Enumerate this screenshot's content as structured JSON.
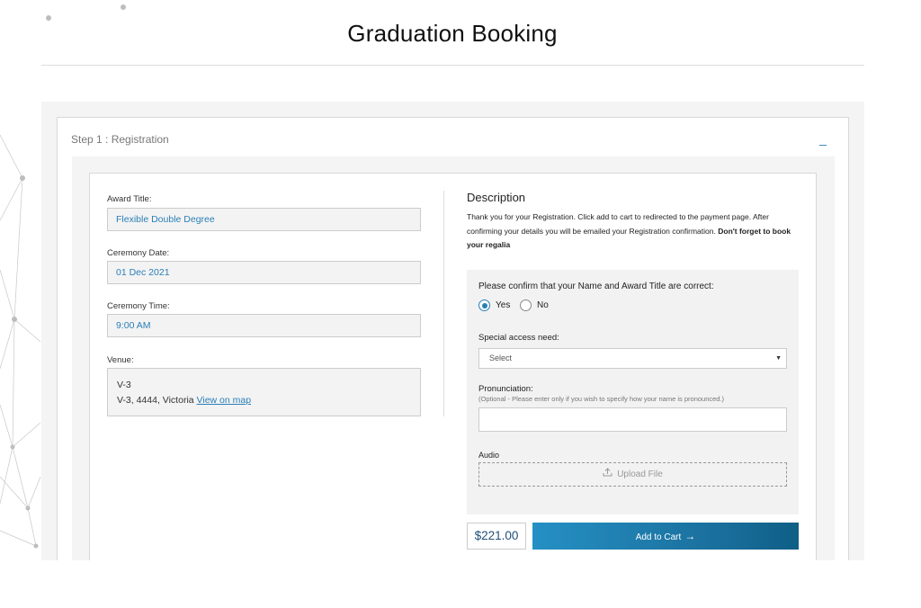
{
  "page": {
    "title": "Graduation Booking"
  },
  "step": {
    "title": "Step 1 : Registration",
    "collapse_symbol": "_"
  },
  "details": {
    "award_title": {
      "label": "Award Title:",
      "value": "Flexible Double Degree"
    },
    "ceremony_date": {
      "label": "Ceremony Date:",
      "value": "01 Dec 2021"
    },
    "ceremony_time": {
      "label": "Ceremony Time:",
      "value": "9:00 AM"
    },
    "venue": {
      "label": "Venue:",
      "name": "V-3",
      "address": "V-3, 4444, Victoria",
      "map_link": "View on map"
    }
  },
  "description": {
    "heading": "Description",
    "text": "Thank you for your Registration. Click add to cart to redirected to the payment page. After confirming your details you will be emailed your Registration confirmation.",
    "emphasis": "Don't forget to book your regalia"
  },
  "confirm": {
    "question": "Please confirm that your Name and Award Title are correct:",
    "options": [
      {
        "label": "Yes",
        "selected": true
      },
      {
        "label": "No",
        "selected": false
      }
    ]
  },
  "special_access": {
    "label": "Special access need:",
    "selected": "Select"
  },
  "pronunciation": {
    "label": "Pronunciation:",
    "hint": "(Optional - Please enter only if you wish to specify how your name is pronounced.)",
    "value": ""
  },
  "audio": {
    "label": "Audio",
    "upload_label": "Upload File"
  },
  "cart": {
    "price": "$221.00",
    "button_label": "Add to Cart",
    "button_arrow": "→"
  },
  "colors": {
    "accent": "#2a7fb8",
    "button_start": "#2590c4",
    "button_end": "#0e5f86"
  },
  "icons": {
    "upload": "upload-icon",
    "arrow": "arrow-right-icon",
    "caret": "caret-down-icon"
  }
}
